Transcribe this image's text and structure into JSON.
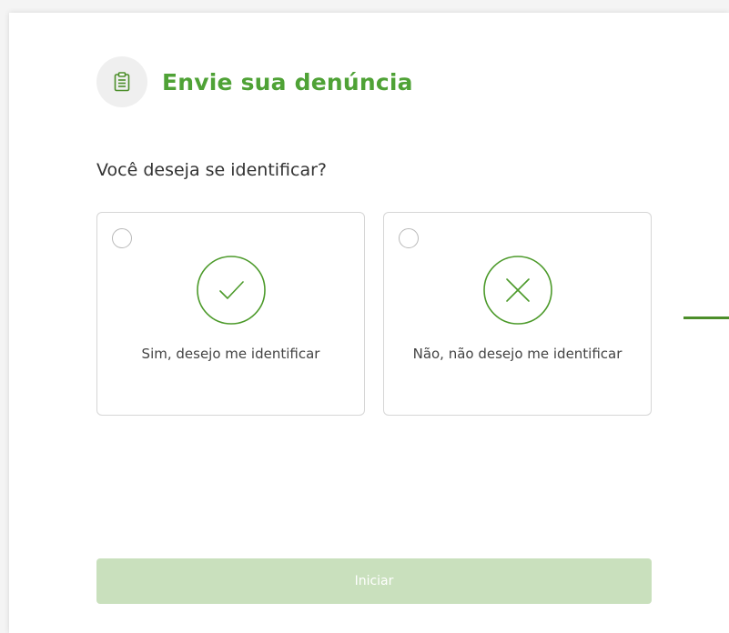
{
  "header": {
    "title": "Envie sua denúncia",
    "icon": "clipboard-icon"
  },
  "question": "Você deseja se identificar?",
  "options": [
    {
      "label": "Sim, desejo me identificar",
      "icon": "check-circle-icon",
      "selected": false
    },
    {
      "label": "Não, não desejo me identificar",
      "icon": "x-circle-icon",
      "selected": false
    }
  ],
  "actions": {
    "start_label": "Iniciar",
    "enabled": false
  },
  "colors": {
    "accent": "#4fa236",
    "icon_green": "#4c9a2a",
    "button_disabled": "#c9e0bd",
    "border": "#d6d6d6"
  }
}
